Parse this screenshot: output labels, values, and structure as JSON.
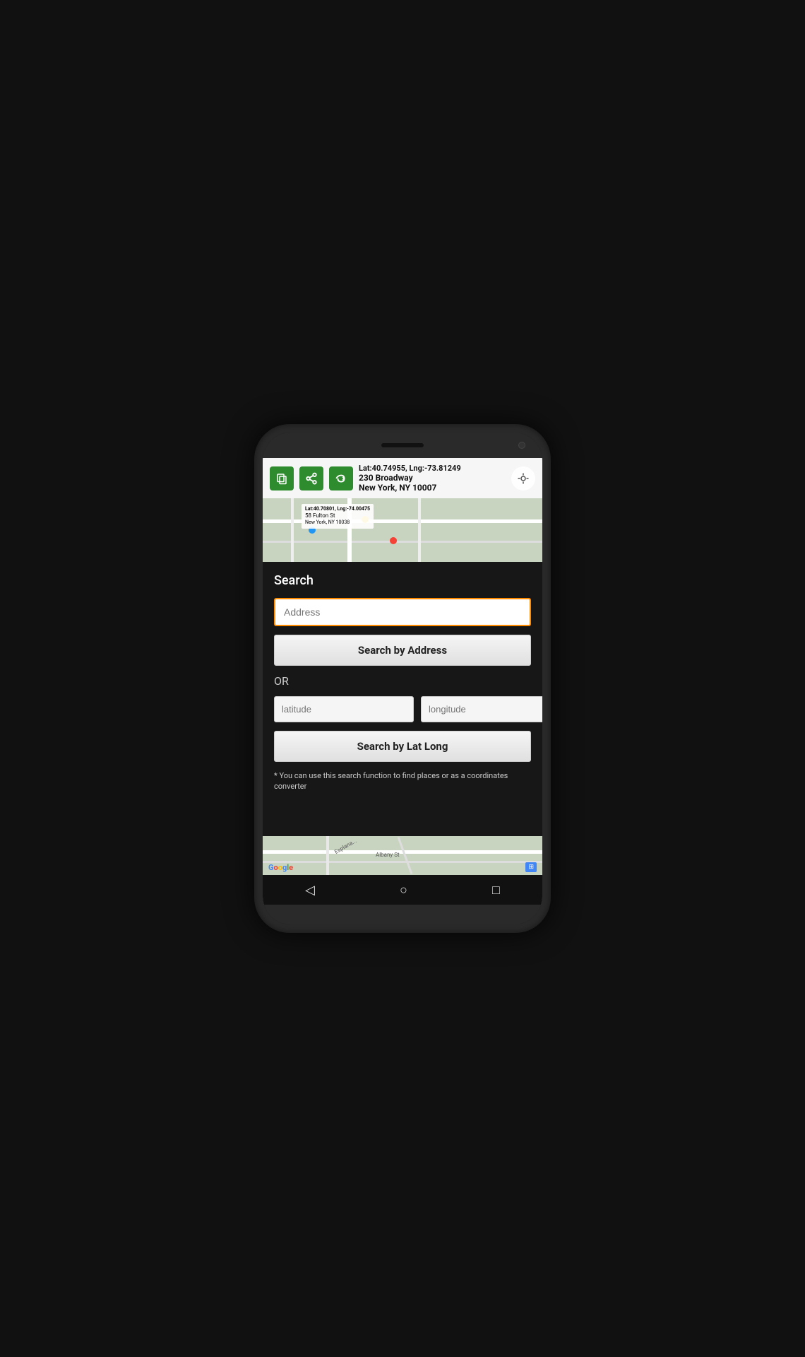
{
  "appBar": {
    "coords": "Lat:40.74955, Lng:-73.81249",
    "address1": "230 Broadway",
    "address2": "New York, NY 10007",
    "icons": {
      "copy": "⧉",
      "share": "⟨",
      "route": "⇄",
      "location": "⊕"
    }
  },
  "mapLabels": {
    "street1": "Esplana...",
    "street2": "Albany St"
  },
  "mapSecondary": {
    "coords": "Lat:40.70801, Lng:-74.00475",
    "address1": "58 Fulton St",
    "address2": "New York, NY 10038"
  },
  "searchDialog": {
    "title": "Search",
    "addressPlaceholder": "Address",
    "searchByAddressLabel": "Search by Address",
    "orLabel": "OR",
    "latPlaceholder": "latitude",
    "lngPlaceholder": "longitude",
    "searchByLatLongLabel": "Search by Lat Long",
    "hintText": "* You can use this search function to find places or as a coordinates converter"
  },
  "navBar": {
    "back": "◁",
    "home": "○",
    "recent": "□"
  },
  "googleLogo": [
    "G",
    "o",
    "o",
    "g",
    "l",
    "e"
  ]
}
